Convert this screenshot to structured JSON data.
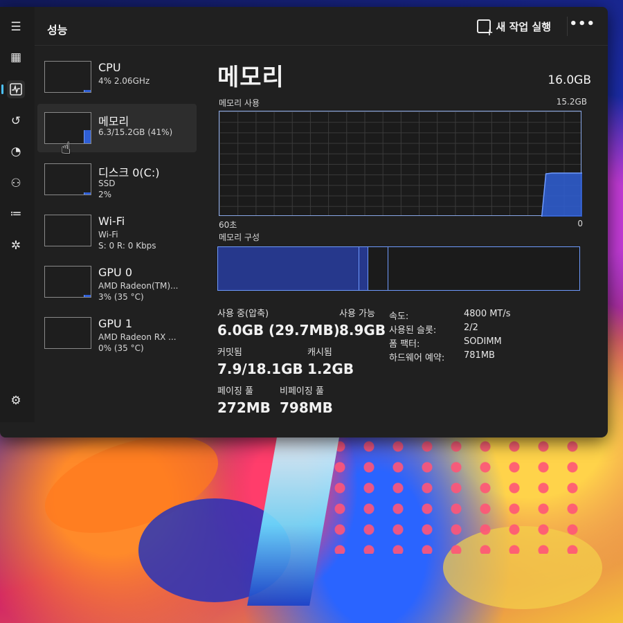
{
  "window": {
    "page_title": "성능",
    "run_new_task_label": "새 작업 실행",
    "more_label": "•••"
  },
  "nav": {
    "icons": [
      "hamburger-menu-icon",
      "processes-icon",
      "performance-icon",
      "app-history-icon",
      "startup-apps-icon",
      "users-icon",
      "details-icon",
      "services-icon",
      "settings-icon"
    ]
  },
  "sidebar": {
    "items": [
      {
        "name": "CPU",
        "sub1": "4% 2.06GHz",
        "sub2": "",
        "fill": 0.06
      },
      {
        "name": "메모리",
        "sub1": "6.3/15.2GB (41%)",
        "sub2": "",
        "fill": 0.41
      },
      {
        "name": "디스크 0(C:)",
        "sub1": "SSD",
        "sub2": "2%",
        "fill": 0.02
      },
      {
        "name": "Wi-Fi",
        "sub1": "Wi-Fi",
        "sub2": "S: 0 R: 0 Kbps",
        "fill": 0
      },
      {
        "name": "GPU 0",
        "sub1": "AMD Radeon(TM)...",
        "sub2": "3% (35 °C)",
        "fill": 0.03
      },
      {
        "name": "GPU 1",
        "sub1": "AMD Radeon RX ...",
        "sub2": "0% (35 °C)",
        "fill": 0
      }
    ],
    "selected_index": 1
  },
  "memory": {
    "title": "메모리",
    "total": "16.0GB",
    "usage_label": "메모리 사용",
    "usage_max": "15.2GB",
    "axis_left": "60초",
    "axis_right": "0",
    "composition_label": "메모리 구성",
    "in_use_label": "사용 중(압축)",
    "in_use_value": "6.0GB (29.7MB)",
    "available_label": "사용 가능",
    "available_value": "8.9GB",
    "committed_label": "커밋됨",
    "committed_value": "7.9/18.1GB",
    "cached_label": "캐시됨",
    "cached_value": "1.2GB",
    "paged_pool_label": "페이징 풀",
    "paged_pool_value": "272MB",
    "nonpaged_pool_label": "비페이징 풀",
    "nonpaged_pool_value": "798MB",
    "properties": [
      {
        "key": "속도:",
        "value": "4800 MT/s"
      },
      {
        "key": "사용된 슬롯:",
        "value": "2/2"
      },
      {
        "key": "폼 팩터:",
        "value": "SODIMM"
      },
      {
        "key": "하드웨어 예약:",
        "value": "781MB"
      }
    ],
    "composition": {
      "in_use": 0.39,
      "modified": 0.025,
      "standby": 0.055
    },
    "history_gb": [
      0,
      0,
      0,
      0,
      0,
      0,
      0,
      0,
      0,
      0,
      0,
      0,
      0,
      0,
      0,
      0,
      0,
      0,
      0,
      0,
      0,
      0,
      0,
      0,
      0,
      0,
      0,
      0,
      0,
      0,
      0,
      0,
      0,
      0,
      0,
      0,
      0,
      0,
      0,
      0,
      0,
      0,
      0,
      0,
      0,
      0,
      0,
      0,
      0,
      0,
      0,
      0,
      0,
      0,
      6.2,
      6.3,
      6.3,
      6.3,
      6.3,
      6.3,
      6.3
    ]
  },
  "colors": {
    "accent": "#4cc2ff",
    "graph_fill": "#2f5fd6",
    "graph_line": "#6f9bff"
  }
}
